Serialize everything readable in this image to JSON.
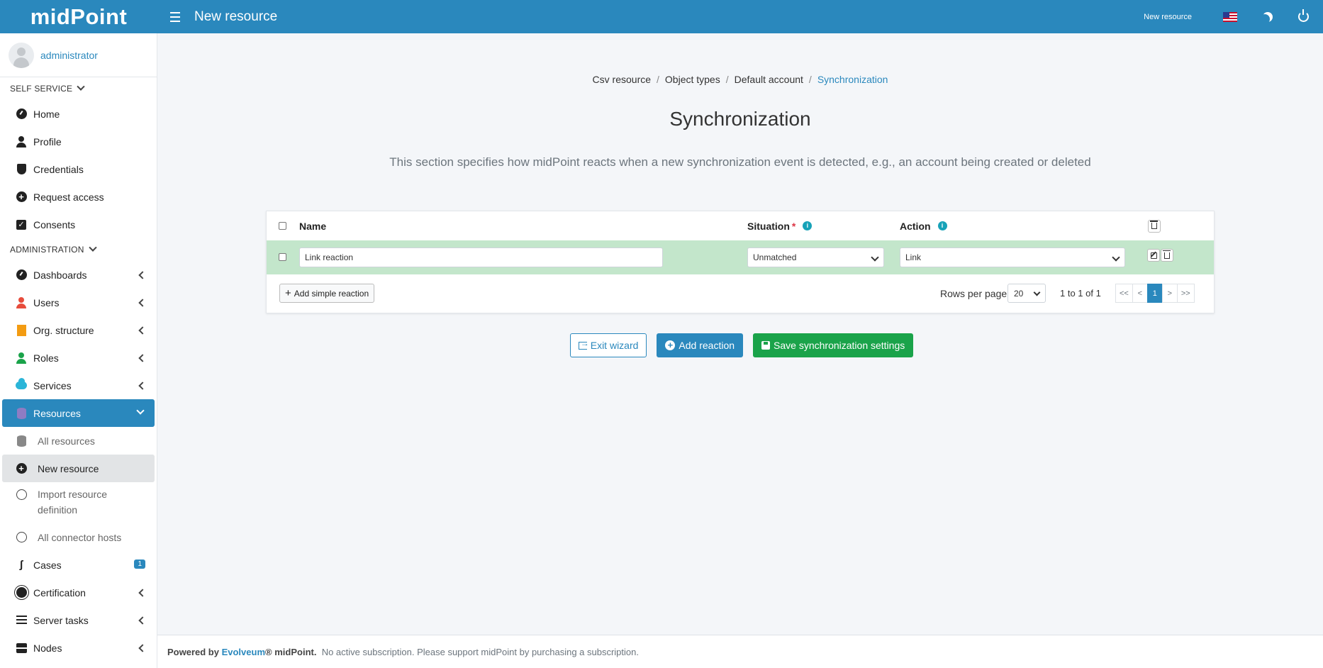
{
  "header": {
    "logo": "midPoint",
    "page_title": "New resource",
    "right_link": "New resource"
  },
  "user": {
    "name": "administrator"
  },
  "sidebar": {
    "self_service_label": "SELF SERVICE",
    "self_service_items": [
      {
        "label": "Home",
        "icon": "dashboard-icon"
      },
      {
        "label": "Profile",
        "icon": "user-icon"
      },
      {
        "label": "Credentials",
        "icon": "shield-icon"
      },
      {
        "label": "Request access",
        "icon": "plus-circle-icon"
      },
      {
        "label": "Consents",
        "icon": "check-square-icon"
      }
    ],
    "administration_label": "ADMINISTRATION",
    "admin_items": [
      {
        "label": "Dashboards"
      },
      {
        "label": "Users"
      },
      {
        "label": "Org. structure"
      },
      {
        "label": "Roles"
      },
      {
        "label": "Services"
      },
      {
        "label": "Resources"
      },
      {
        "label": "All resources"
      },
      {
        "label": "New resource"
      },
      {
        "label": "Import resource definition"
      },
      {
        "label": "All connector hosts"
      },
      {
        "label": "Cases",
        "badge": "1"
      },
      {
        "label": "Certification"
      },
      {
        "label": "Server tasks"
      },
      {
        "label": "Nodes"
      }
    ]
  },
  "breadcrumb": [
    "Csv resource",
    "Object types",
    "Default account",
    "Synchronization"
  ],
  "main": {
    "title": "Synchronization",
    "description": "This section specifies how midPoint reacts when a new synchronization event is detected, e.g., an account being created or deleted"
  },
  "table": {
    "columns": {
      "name": "Name",
      "situation": "Situation",
      "situation_required": "*",
      "action": "Action"
    },
    "rows": [
      {
        "name": "Link reaction",
        "situation": "Unmatched",
        "action": "Link"
      }
    ],
    "add_simple_reaction": "Add simple reaction",
    "rows_per_page_label": "Rows per page",
    "rows_per_page": "20",
    "count_text": "1 to 1 of 1",
    "pager": [
      "<<",
      "<",
      "1",
      ">",
      ">>"
    ]
  },
  "buttons": {
    "exit": "Exit wizard",
    "add_reaction": "Add reaction",
    "save": "Save synchronization settings"
  },
  "footer": {
    "powered_by": "Powered by",
    "brand": "Evolveum",
    "registered": "®",
    "product": "midPoint.",
    "notice": "No active subscription. Please support midPoint by purchasing a subscription."
  },
  "colors": {
    "primary": "#2a88bd",
    "success": "#1aa34a",
    "row_highlight": "#c3e6cb"
  }
}
